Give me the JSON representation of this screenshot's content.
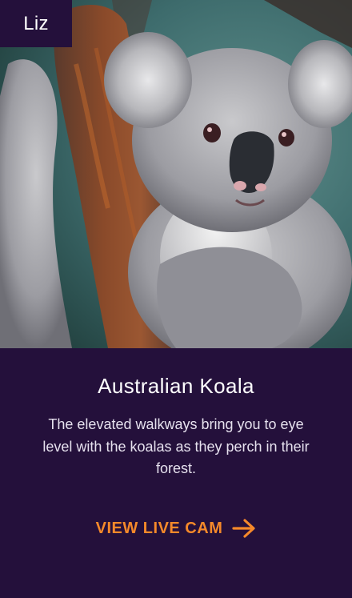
{
  "badge": {
    "name": "Liz"
  },
  "card": {
    "title": "Australian Koala",
    "description": "The elevated walkways bring you to eye level with the koalas as they perch in their forest.",
    "cta_label": "VIEW LIVE CAM"
  },
  "photo": {
    "subject": "koala-photo"
  },
  "colors": {
    "background": "#24103b",
    "accent": "#f5892a",
    "text": "#ffffff"
  },
  "icons": {
    "cta": "arrow-right-icon"
  }
}
